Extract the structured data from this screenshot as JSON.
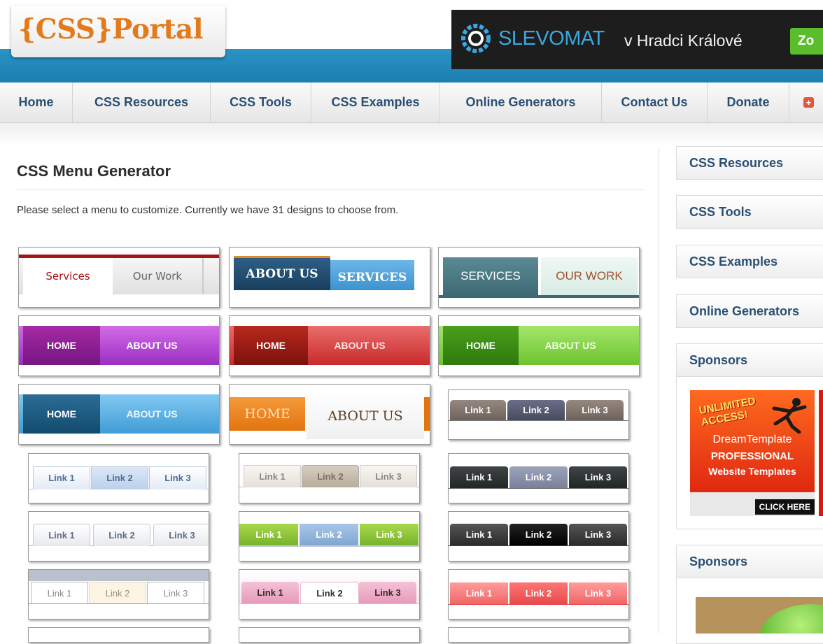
{
  "header": {
    "logo_text": "{CSS}Portal",
    "ad": {
      "brand": "SLEVOMAT",
      "city": "v Hradci Králové",
      "cta": "Zo"
    }
  },
  "nav": {
    "items": [
      "Home",
      "CSS Resources",
      "CSS Tools",
      "CSS Examples",
      "Online Generators",
      "Contact Us",
      "Donate"
    ]
  },
  "main": {
    "title": "CSS Menu Generator",
    "intro": "Please select a menu to customize. Currently we have 31 designs to choose from."
  },
  "menus": [
    {
      "tabs": [
        "Services",
        "Our Work"
      ]
    },
    {
      "tabs": [
        "ABOUT US",
        "SERVICES"
      ]
    },
    {
      "tabs": [
        "SERVICES",
        "OUR WORK"
      ]
    },
    {
      "tabs": [
        "HOME",
        "ABOUT US"
      ]
    },
    {
      "tabs": [
        "HOME",
        "ABOUT US"
      ]
    },
    {
      "tabs": [
        "HOME",
        "ABOUT US"
      ]
    },
    {
      "tabs": [
        "HOME",
        "ABOUT US"
      ]
    },
    {
      "tabs": [
        "HOME",
        "ABOUT US"
      ]
    },
    {
      "tabs": [
        "Link 1",
        "Link 2",
        "Link 3"
      ]
    },
    {
      "tabs": [
        "Link 1",
        "Link 2",
        "Link 3"
      ]
    },
    {
      "tabs": [
        "Link 1",
        "Link 2",
        "Link 3"
      ]
    },
    {
      "tabs": [
        "Link 1",
        "Link 2",
        "Link 3"
      ]
    },
    {
      "tabs": [
        "Link 1",
        "Link 2",
        "Link 3"
      ]
    },
    {
      "tabs": [
        "Link 1",
        "Link 2",
        "Link 3"
      ]
    },
    {
      "tabs": [
        "Link 1",
        "Link 2",
        "Link 3"
      ]
    },
    {
      "tabs": [
        "Link 1",
        "Link 2",
        "Link 3"
      ]
    },
    {
      "tabs": [
        "Link 1",
        "Link 2",
        "Link 3"
      ]
    },
    {
      "tabs": [
        "Link 1",
        "Link 2",
        "Link 3"
      ]
    }
  ],
  "sidebar": {
    "links": [
      "CSS Resources",
      "CSS Tools",
      "CSS Examples",
      "Online Generators"
    ],
    "sponsors_title": "Sponsors",
    "sponsors2_title": "Sponsors",
    "dreamtemplate_ad": {
      "line1": "UNLIMITED",
      "line1b": "ACCESS!",
      "line2": "DreamTemplate",
      "line3": "PROFESSIONAL",
      "line4": "Website Templates",
      "cta": "CLICK HERE"
    }
  },
  "colors": {
    "accent_orange": "#e37b1c",
    "nav_text": "#2a4f73",
    "header_blue": "#1c7fb0"
  }
}
